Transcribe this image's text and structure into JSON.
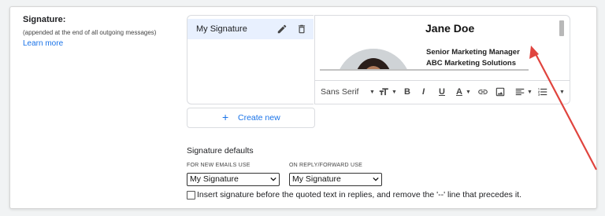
{
  "section": {
    "title": "Signature:",
    "note": "(appended at the end of all outgoing messages)",
    "learn_more": "Learn more"
  },
  "signatures": [
    {
      "label": "My Signature"
    }
  ],
  "preview": {
    "name": "Jane Doe",
    "role": "Senior Marketing Manager",
    "company": "ABC Marketing Solutions"
  },
  "toolbar": {
    "font": "Sans Serif",
    "bold": "B",
    "italic": "I",
    "underline": "U",
    "text_color": "A"
  },
  "create_new": "Create new",
  "defaults": {
    "title": "Signature defaults",
    "new_emails_label": "FOR NEW EMAILS USE",
    "new_emails_value": "My Signature",
    "reply_label": "ON REPLY/FORWARD USE",
    "reply_value": "My Signature"
  },
  "insert_before_quoted": "Insert signature before the quoted text in replies, and remove the '--' line that precedes it.",
  "insert_before_quoted_checked": false,
  "colors": {
    "accent": "#1a73e8",
    "selected_row": "#e8f0fe",
    "annotation_arrow": "#e0443e"
  }
}
